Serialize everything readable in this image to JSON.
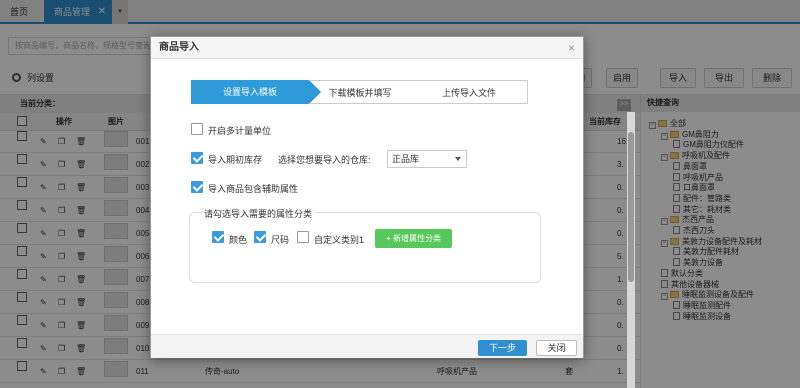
{
  "tabs": {
    "home": "首页",
    "active": "商品管理",
    "close": "✕",
    "more": "▾"
  },
  "search": {
    "placeholder": "按商品编号，商品名称，规格型号查询"
  },
  "toolbar": {
    "column_settings": "列设置",
    "buttons": [
      "用",
      "启用",
      "导入",
      "导出",
      "删除"
    ]
  },
  "grid": {
    "current_category": "当前分类：",
    "headers": {
      "op": "操作",
      "image": "图片",
      "stock": "当前库存"
    },
    "toggle": ">>",
    "rows": [
      {
        "code": "001",
        "stock": "16."
      },
      {
        "code": "002",
        "stock": "3."
      },
      {
        "code": "003",
        "stock": "0."
      },
      {
        "code": "004",
        "stock": "0."
      },
      {
        "code": "005",
        "stock": "0."
      },
      {
        "code": "006",
        "stock": "5."
      },
      {
        "code": "007",
        "stock": "1."
      },
      {
        "code": "008",
        "stock": "0."
      },
      {
        "code": "009",
        "stock": "0."
      },
      {
        "code": "010",
        "stock": "0."
      },
      {
        "code": "011",
        "name": "传奇-auto",
        "category": "呼吸机产品",
        "unit": "套",
        "stock": "1."
      }
    ]
  },
  "quick_search": {
    "title": "快捷查询",
    "tree": [
      {
        "label": "全部",
        "level": 0,
        "type": "folder"
      },
      {
        "label": "GM鼻阻力",
        "level": 1,
        "type": "folder"
      },
      {
        "label": "GM鼻阻力仪配件",
        "level": 2,
        "type": "doc"
      },
      {
        "label": "呼吸机及配件",
        "level": 1,
        "type": "folder"
      },
      {
        "label": "鼻面罩",
        "level": 2,
        "type": "doc"
      },
      {
        "label": "呼吸机产品",
        "level": 2,
        "type": "doc"
      },
      {
        "label": "口鼻面罩",
        "level": 2,
        "type": "doc"
      },
      {
        "label": "配件：管路类",
        "level": 2,
        "type": "doc"
      },
      {
        "label": "其它：耗材类",
        "level": 2,
        "type": "doc"
      },
      {
        "label": "杰西产品",
        "level": 1,
        "type": "folder"
      },
      {
        "label": "杰西刀头",
        "level": 2,
        "type": "doc"
      },
      {
        "label": "美敦力设备配件及耗材",
        "level": 1,
        "type": "folder"
      },
      {
        "label": "美敦力配件耗材",
        "level": 2,
        "type": "doc"
      },
      {
        "label": "美敦力设备",
        "level": 2,
        "type": "doc"
      },
      {
        "label": "默认分类",
        "level": 1,
        "type": "doc"
      },
      {
        "label": "其他设备器械",
        "level": 1,
        "type": "doc"
      },
      {
        "label": "睡眠监测设备及配件",
        "level": 1,
        "type": "folder"
      },
      {
        "label": "睡眠监测配件",
        "level": 2,
        "type": "doc"
      },
      {
        "label": "睡眠监测设备",
        "level": 2,
        "type": "doc"
      }
    ]
  },
  "dialog": {
    "title": "商品导入",
    "close": "×",
    "steps": [
      "设置导入模板",
      "下载模板并填写",
      "上传导入文件"
    ],
    "multi_unit": {
      "label": "开启多计量单位",
      "checked": false
    },
    "import_opening": {
      "label": "导入期初库存",
      "checked": true
    },
    "warehouse_prompt": "选择您想要导入的仓库:",
    "warehouse_value": "正品库",
    "aux_attr": {
      "label": "导入商品包含辅助属性",
      "checked": true
    },
    "attr_legend": "请勾选导入需要的属性分类",
    "attrs": [
      {
        "label": "颜色",
        "checked": true
      },
      {
        "label": "尺码",
        "checked": true
      },
      {
        "label": "自定义类别1",
        "checked": false
      }
    ],
    "add_attr": "+ 新增属性分类",
    "next": "下一步",
    "close_btn": "关闭"
  }
}
